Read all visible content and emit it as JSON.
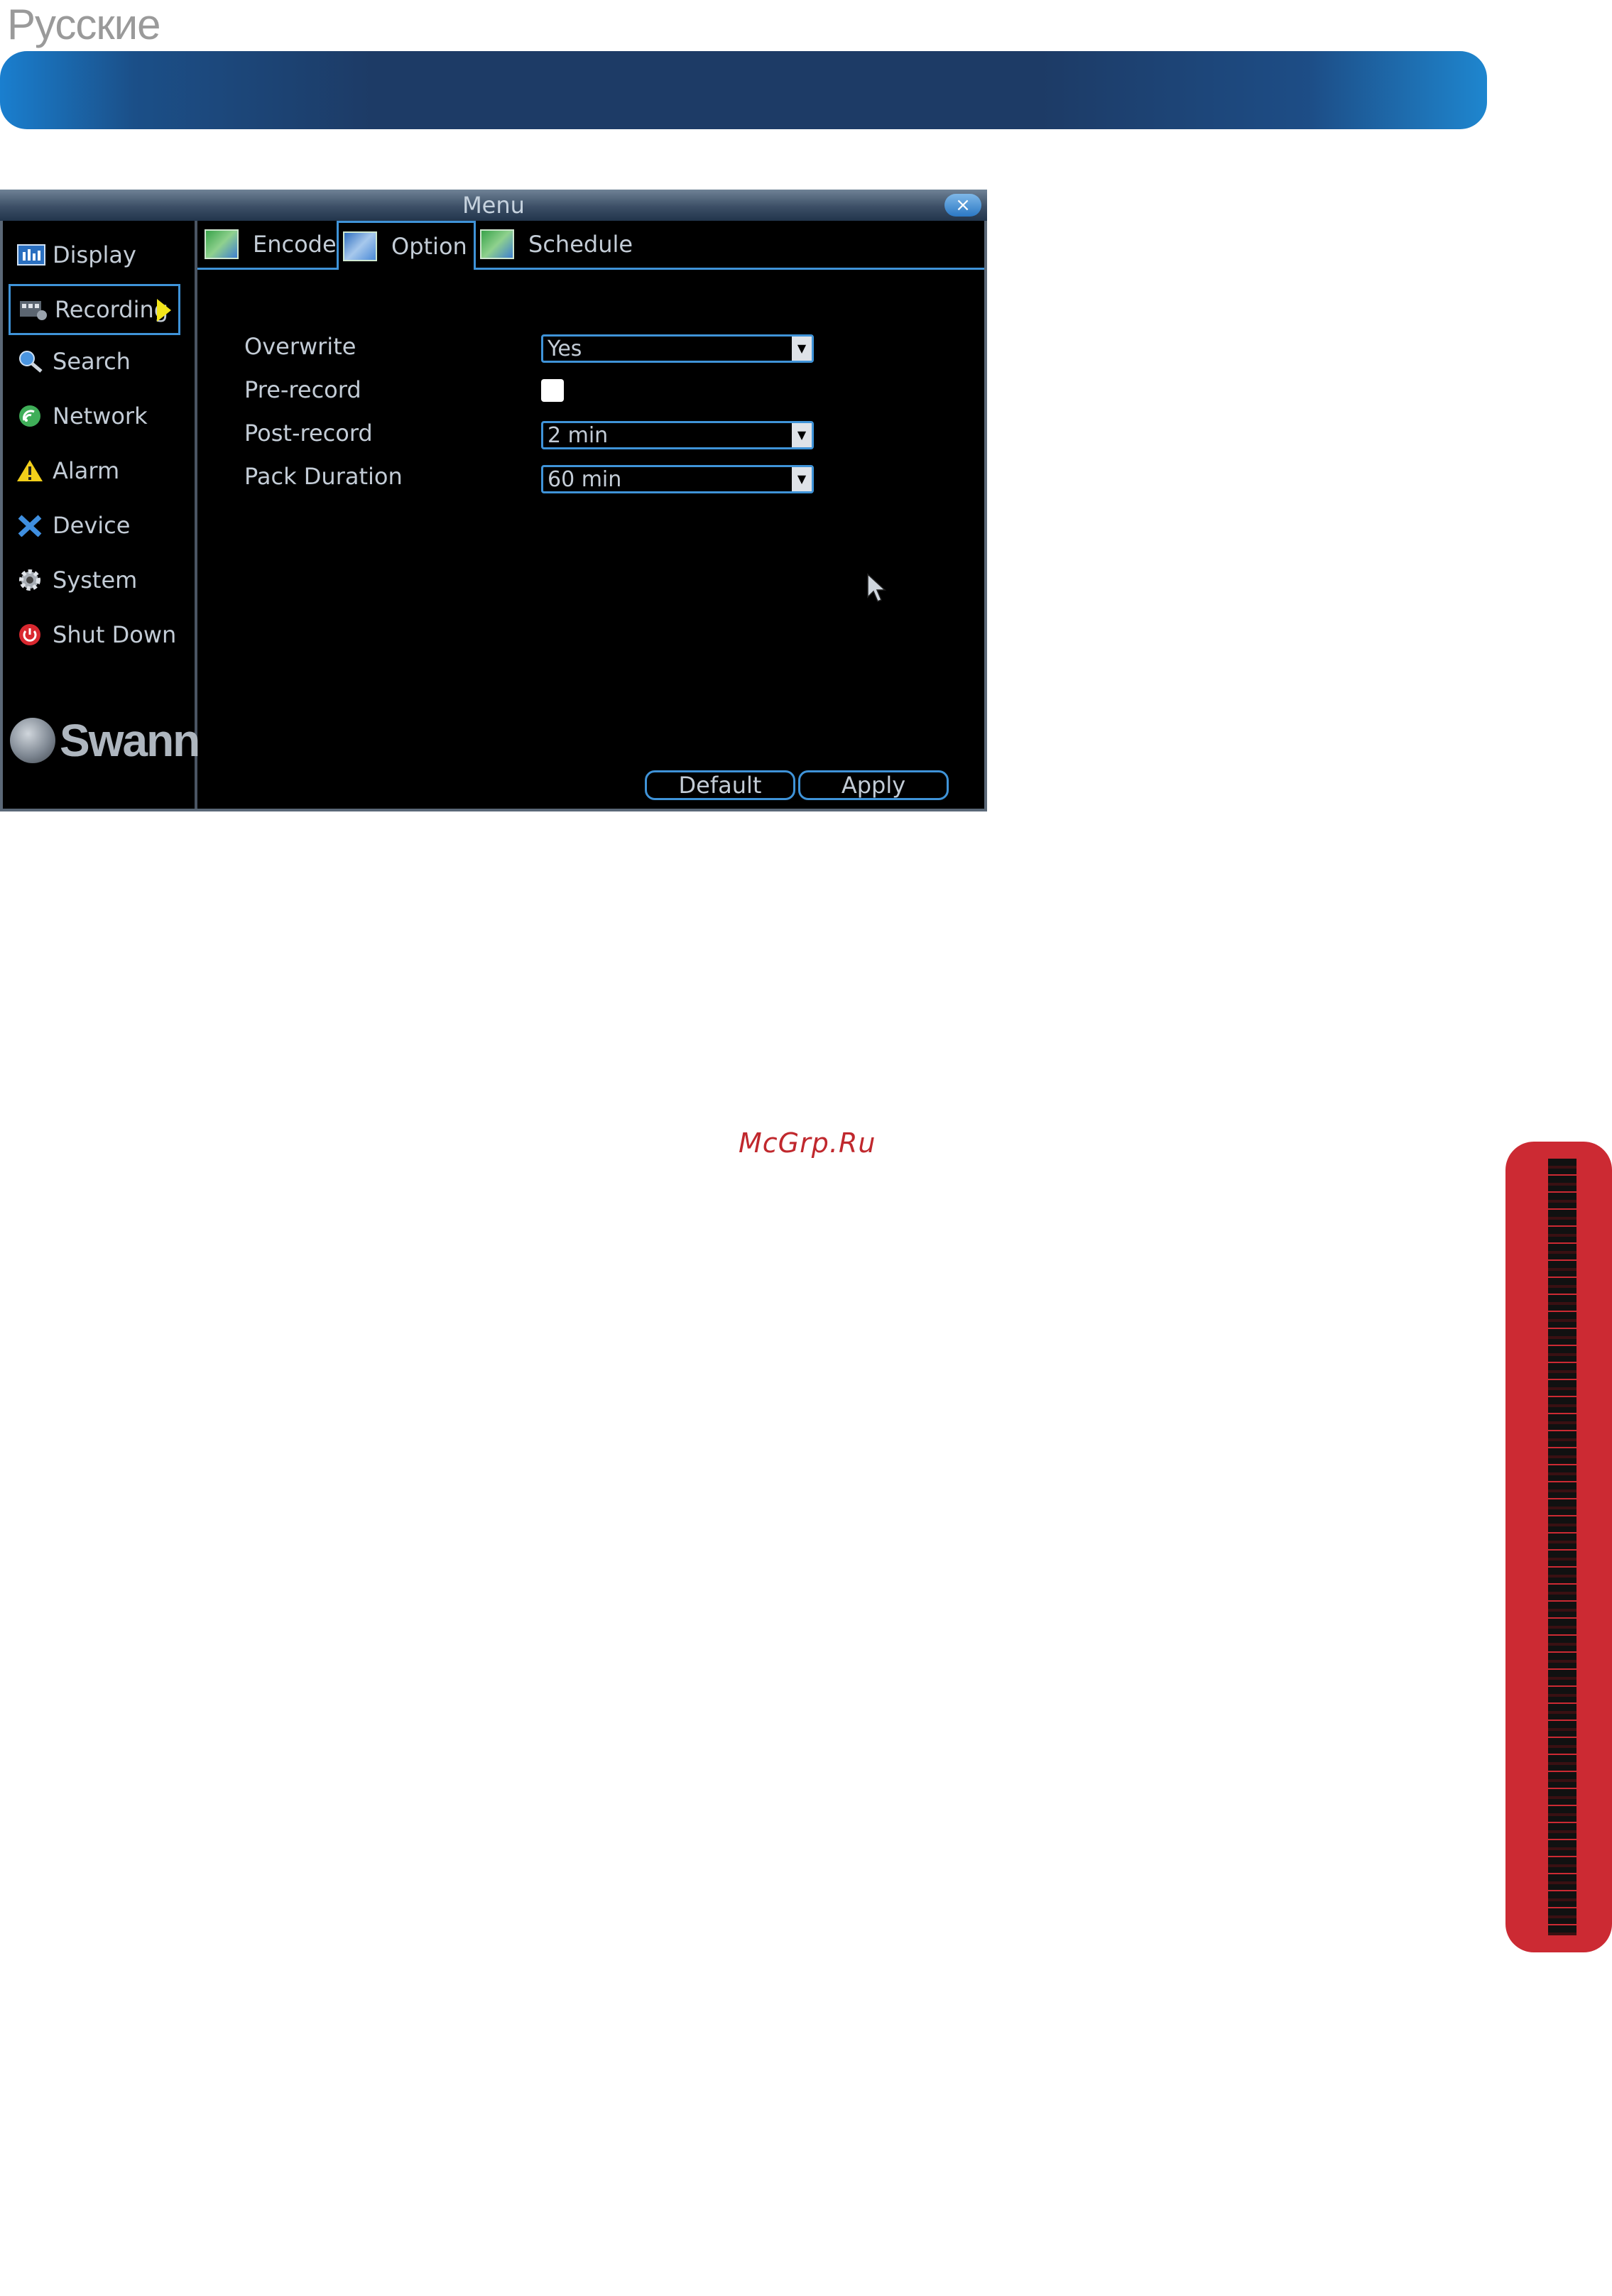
{
  "page": {
    "language_title": "Русские",
    "watermark": "McGrp.Ru",
    "banner_color": "#1d3b66",
    "side_tab_color": "#cc2a33"
  },
  "menu": {
    "title": "Menu",
    "close_glyph": "×",
    "sidebar": [
      {
        "label": "Display",
        "icon": "display-icon",
        "active": false
      },
      {
        "label": "Recording",
        "icon": "recording-icon",
        "active": true
      },
      {
        "label": "Search",
        "icon": "search-icon",
        "active": false
      },
      {
        "label": "Network",
        "icon": "network-icon",
        "active": false
      },
      {
        "label": "Alarm",
        "icon": "alarm-icon",
        "active": false
      },
      {
        "label": "Device",
        "icon": "device-icon",
        "active": false
      },
      {
        "label": "System",
        "icon": "system-icon",
        "active": false
      },
      {
        "label": "Shut Down",
        "icon": "shutdown-icon",
        "active": false
      }
    ],
    "logo_text": "Swann",
    "tabs": [
      {
        "label": "Encode",
        "active": false
      },
      {
        "label": "Option",
        "active": true
      },
      {
        "label": "Schedule",
        "active": false
      }
    ],
    "fields": {
      "overwrite": {
        "label": "Overwrite",
        "value": "Yes"
      },
      "pre_record": {
        "label": "Pre-record",
        "checked": false
      },
      "post_record": {
        "label": "Post-record",
        "value": "2 min"
      },
      "pack_duration": {
        "label": "Pack Duration",
        "value": "60 min"
      }
    },
    "buttons": {
      "default": "Default",
      "apply": "Apply"
    },
    "accent_color": "#3f93d8"
  }
}
